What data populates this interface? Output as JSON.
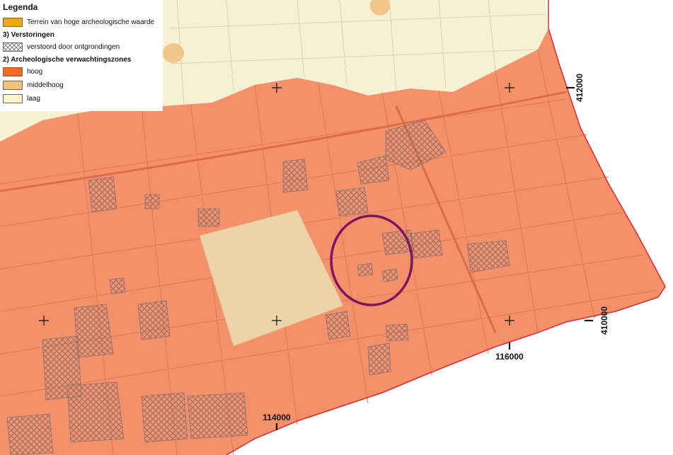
{
  "legend": {
    "title": "Legenda",
    "items": [
      {
        "label": "Terrein van hoge archeologische waarde",
        "color": "#f6a41c"
      },
      {
        "label": "verstoord door ontgrondingen",
        "pattern": "crosshatch"
      }
    ],
    "sections": [
      {
        "label": "3) Verstoringen"
      },
      {
        "label": "2) Archeologische verwachtingszones"
      }
    ],
    "zones": [
      {
        "label": "hoog",
        "color": "#f26a1d"
      },
      {
        "label": "middelhoog",
        "color": "#f3c27a"
      },
      {
        "label": "laag",
        "color": "#fbf4c6"
      }
    ]
  },
  "map": {
    "colors": {
      "high_zone": "#f4906a",
      "medium_zone": "#edd3a6",
      "low_zone": "#f6f1d2",
      "boundary": "#e8262b",
      "marker_circle": "#7b1660"
    },
    "grid_labels": {
      "x_114000": "114000",
      "x_116000": "116000",
      "y_412000": "412000",
      "y_410000": "410000"
    }
  }
}
